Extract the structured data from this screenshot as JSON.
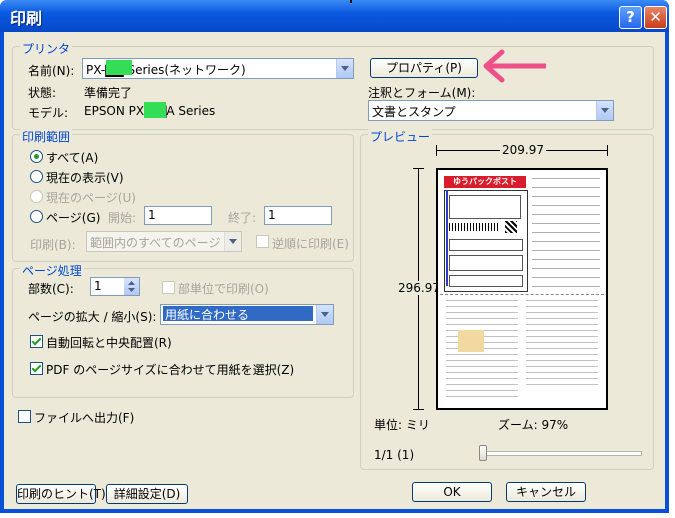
{
  "window": {
    "title": "印刷",
    "help_glyph": "?",
    "close_glyph": "✕"
  },
  "printer": {
    "group_label": "プリンタ",
    "name_label": "名前(N):",
    "name_value": "PX-▇▇ Series(ネットワーク)",
    "status_label": "状態:",
    "status_value": "準備完了",
    "model_label": "モデル:",
    "model_value": "EPSON PX-▇▇A Series",
    "properties_button": "プロパティ(P)",
    "annotations_label": "注釈とフォーム(M):",
    "annotations_value": "文書とスタンプ"
  },
  "print_range": {
    "group_label": "印刷範囲",
    "all": "すべて(A)",
    "current_view": "現在の表示(V)",
    "current_page": "現在のページ(U)",
    "pages": "ページ(G)",
    "start_label": "開始:",
    "start_value": "1",
    "end_label": "終了:",
    "end_value": "1",
    "print_label": "印刷(B):",
    "print_value": "範囲内のすべてのページ",
    "reverse": "逆順に印刷(E)"
  },
  "page_handling": {
    "group_label": "ページ処理",
    "copies_label": "部数(C):",
    "copies_value": "1",
    "collate": "部単位で印刷(O)",
    "scaling_label": "ページの拡大 / 縮小(S):",
    "scaling_value": "用紙に合わせる",
    "auto_rotate": "自動回転と中央配置(R)",
    "pdf_page_size": "PDF のページサイズに合わせて用紙を選択(Z)"
  },
  "print_to_file": "ファイルへ出力(F)",
  "preview": {
    "group_label": "プレビュー",
    "width_value": "209.97",
    "height_value": "296.97",
    "unit": "単位: ミリ",
    "zoom": "ズーム: 97%",
    "page_indicator": "1/1 (1)",
    "doc_header": "ゆうパックポスト",
    "slider_position": 0.0
  },
  "footer": {
    "tips_button": "印刷のヒント(T)",
    "advanced_button": "詳細設定(D)",
    "ok_button": "OK",
    "cancel_button": "キャンセル"
  },
  "colors": {
    "title_blue": "#0a5ae0",
    "dialog_bg": "#ece9d8",
    "group_label": "#0046d5",
    "arrow": "#f0508a",
    "redaction": "#33dd55"
  }
}
